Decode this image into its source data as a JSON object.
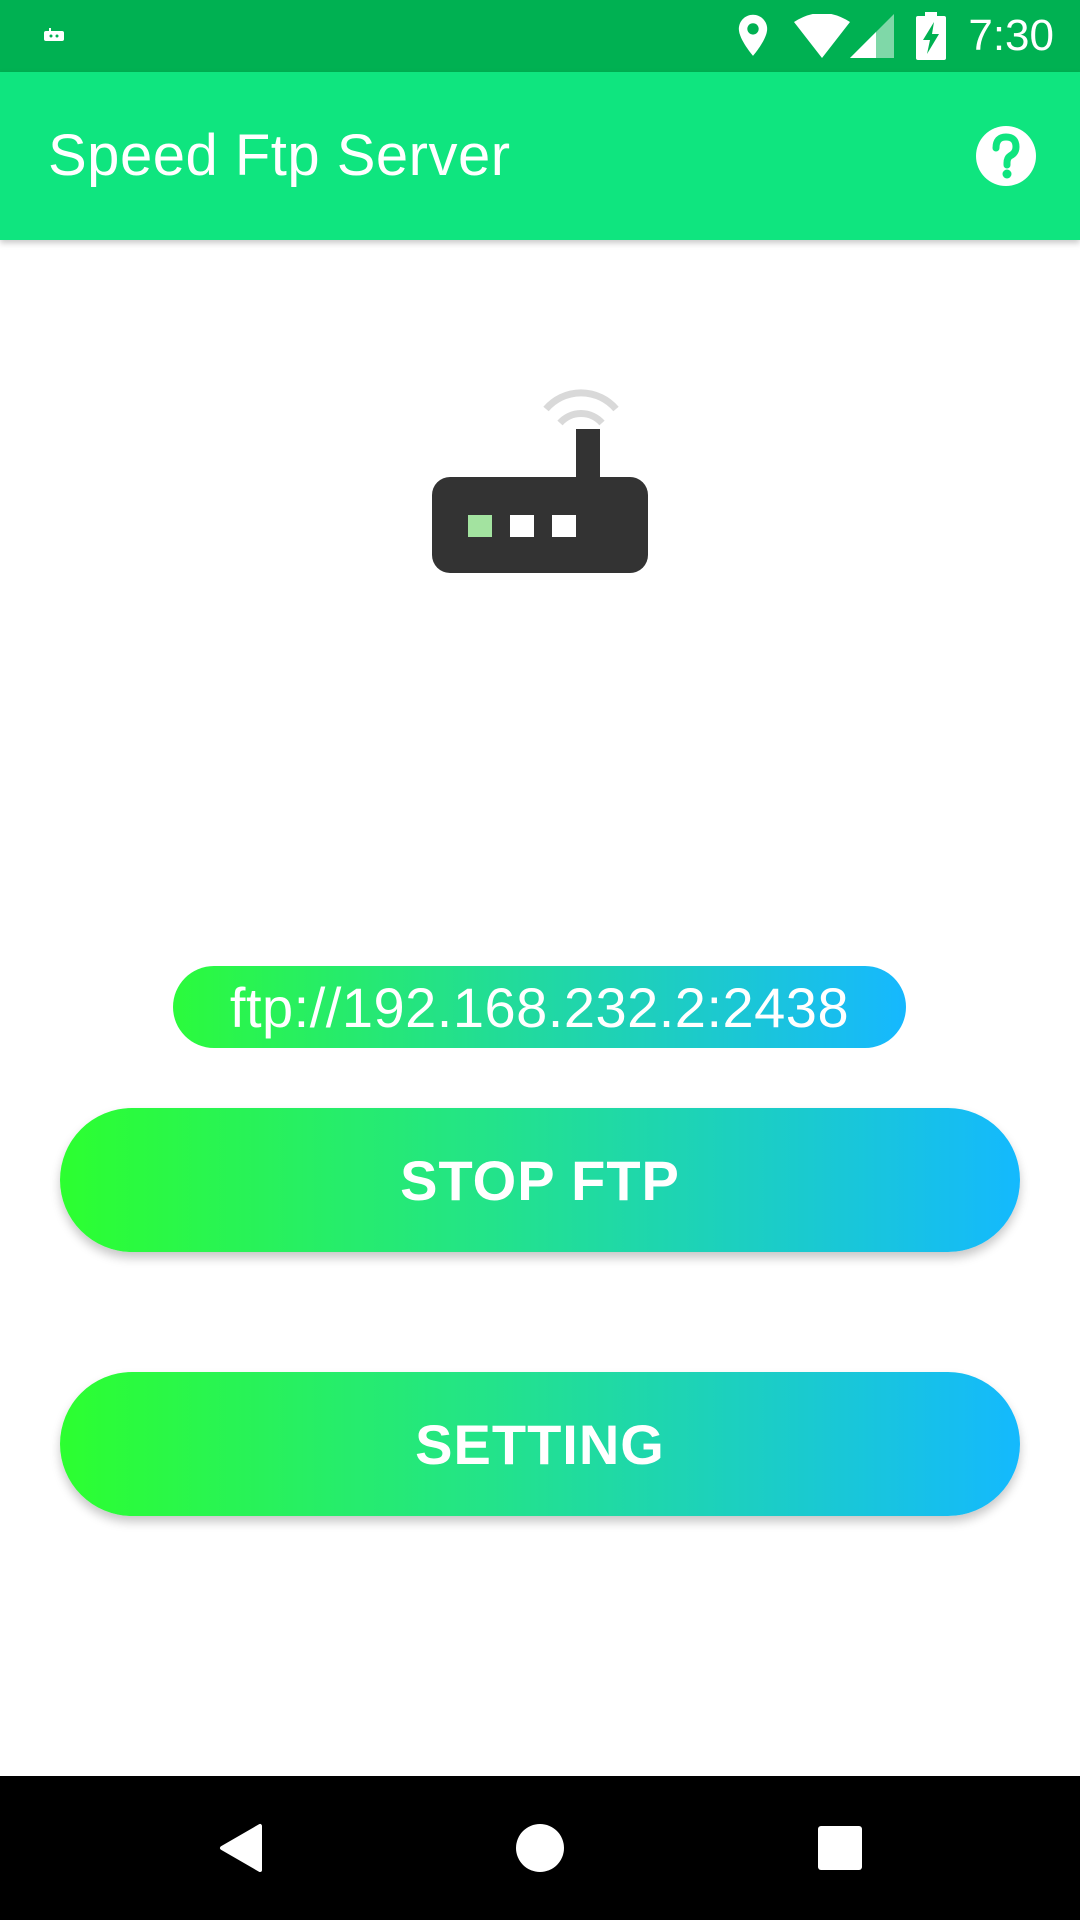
{
  "status_bar": {
    "time": "7:30",
    "icons": [
      "android-debug-icon",
      "location-icon",
      "wifi-icon",
      "signal-icon",
      "battery-charging-icon"
    ]
  },
  "app_bar": {
    "title": "Speed Ftp Server",
    "help_icon": "help-circle-icon"
  },
  "main": {
    "illustration_icon": "router-icon",
    "ftp_address": "ftp://192.168.232.2:2438",
    "stop_button_label": "STOP FTP",
    "setting_button_label": "SETTING"
  },
  "nav_bar": {
    "icons": [
      "back-icon",
      "home-icon",
      "recents-icon"
    ]
  },
  "colors": {
    "status_bar": "#00b152",
    "app_bar": "#0fe57f",
    "gradient_start": "#2cff30",
    "gradient_end": "#14b9fe",
    "router_body": "#333333",
    "router_led_active": "#a3e3a0",
    "wifi_waves": "#d9d9d9"
  }
}
